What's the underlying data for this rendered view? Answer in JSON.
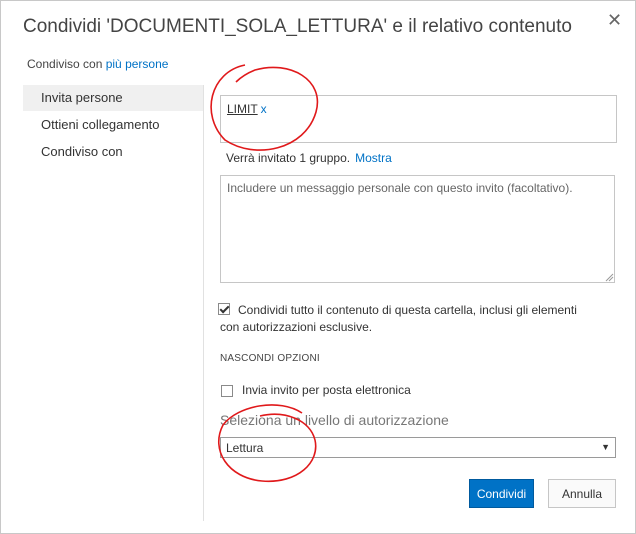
{
  "dialog": {
    "title": "Condividi 'DOCUMENTI_SOLA_LETTURA' e il relativo contenuto",
    "close_icon": "close-icon"
  },
  "shared_with": {
    "prefix": "Condiviso con",
    "link": "più persone"
  },
  "nav": {
    "items": [
      {
        "label": "Invita persone",
        "active": true
      },
      {
        "label": "Ottieni collegamento",
        "active": false
      },
      {
        "label": "Condiviso con",
        "active": false
      }
    ]
  },
  "people": {
    "token": "LIMIT",
    "remove": "x"
  },
  "invite_info": {
    "text": "Verrà invitato 1 gruppo.",
    "link": "Mostra"
  },
  "message": {
    "placeholder": "Includere un messaggio personale con questo invito (facoltativo)."
  },
  "share_all": {
    "checked": true,
    "line1": "Condividi tutto il contenuto di questa cartella, inclusi gli elementi",
    "line2": "con autorizzazioni esclusive."
  },
  "hide_options": "NASCONDI OPZIONI",
  "send_email": {
    "checked": false,
    "label": "Invia invito per posta elettronica"
  },
  "permission": {
    "label": "Seleziona un livello di autorizzazione",
    "selected": "Lettura"
  },
  "buttons": {
    "share": "Condividi",
    "cancel": "Annulla"
  },
  "colors": {
    "accent": "#0072c6",
    "annotation": "#e0191b"
  }
}
